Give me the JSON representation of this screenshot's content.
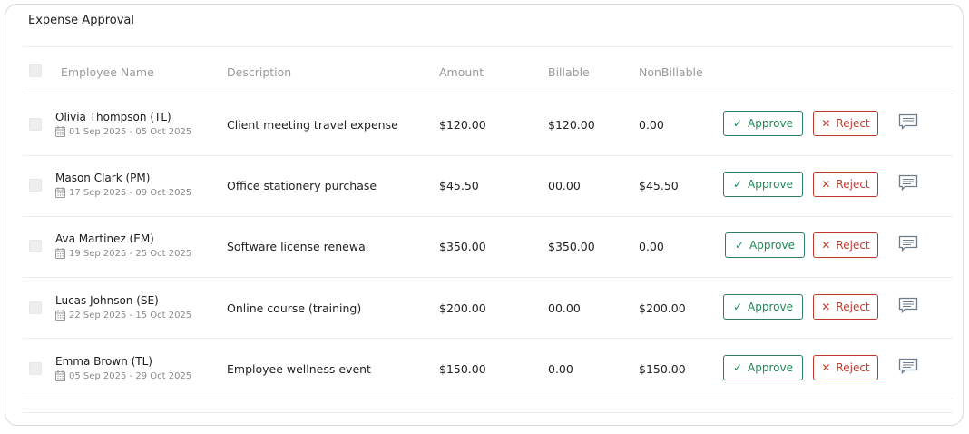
{
  "card": {
    "title": "Expense Approval"
  },
  "table": {
    "headers": {
      "employee": "Employee Name",
      "description": "Description",
      "amount": "Amount",
      "billable": "Billable",
      "nonbillable": "NonBillable"
    },
    "rows": [
      {
        "name": "Olivia Thompson (TL)",
        "dates": "01 Sep 2025 - 05 Oct 2025",
        "description": "Client meeting travel expense",
        "amount": "$120.00",
        "billable": "$120.00",
        "nonbillable": "0.00",
        "approve": "Approve",
        "reject": "Reject"
      },
      {
        "name": "Mason Clark (PM)",
        "dates": "17 Sep 2025 - 09 Oct 2025",
        "description": "Office stationery purchase",
        "amount": "$45.50",
        "billable": "00.00",
        "nonbillable": "$45.50",
        "approve": "Approve",
        "reject": "Reject"
      },
      {
        "name": "Ava Martinez (EM)",
        "dates": "19 Sep 2025 - 25 Oct 2025",
        "description": "Software license renewal",
        "amount": "$350.00",
        "billable": "$350.00",
        "nonbillable": "0.00",
        "approve": "Approve",
        "reject": "Reject"
      },
      {
        "name": "Lucas Johnson (SE)",
        "dates": "22 Sep 2025 - 15 Oct 2025",
        "description": "Online course (training)",
        "amount": "$200.00",
        "billable": "00.00",
        "nonbillable": "$200.00",
        "approve": "Approve",
        "reject": "Reject"
      },
      {
        "name": "Emma Brown (TL)",
        "dates": "05 Sep 2025 - 29 Oct 2025",
        "description": "Employee wellness event",
        "amount": "$150.00",
        "billable": "0.00",
        "nonbillable": "$150.00",
        "approve": "Approve",
        "reject": "Reject"
      }
    ]
  },
  "icons": {
    "approve": "check-icon",
    "reject": "x-icon",
    "comment": "comment-icon",
    "calendar": "calendar-icon"
  },
  "colors": {
    "approve": "#1f8a57",
    "reject": "#c43b30",
    "border": "#d8d8d8"
  }
}
